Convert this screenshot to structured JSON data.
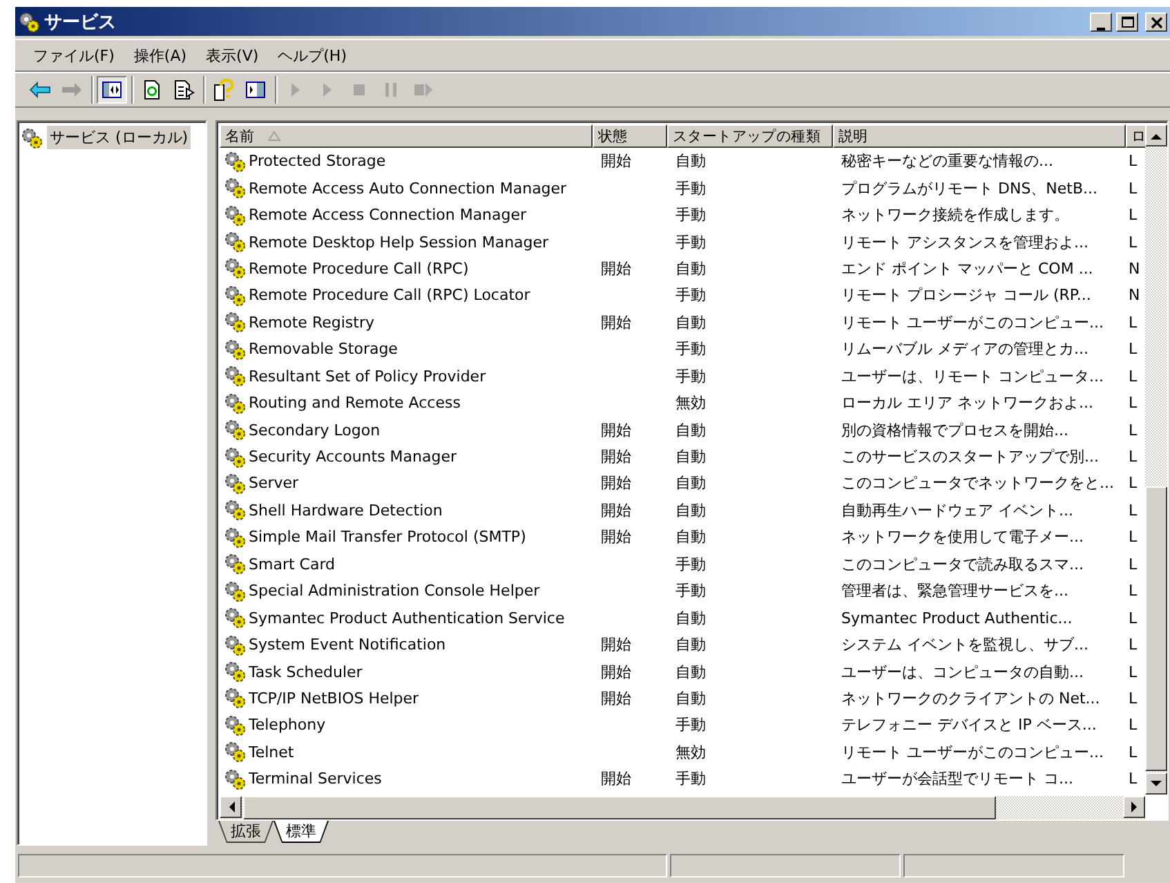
{
  "window": {
    "title": "サービス"
  },
  "menu": [
    "ファイル(F)",
    "操作(A)",
    "表示(V)",
    "ヘルプ(H)"
  ],
  "toolbar": {
    "groups": [
      [
        {
          "kind": "back",
          "disabled": false,
          "pressed": false
        },
        {
          "kind": "forward",
          "disabled": false,
          "pressed": false
        }
      ],
      [
        {
          "kind": "tree",
          "disabled": false,
          "pressed": true
        }
      ],
      [
        {
          "kind": "refresh",
          "disabled": false,
          "pressed": false
        },
        {
          "kind": "export",
          "disabled": false,
          "pressed": false
        }
      ],
      [
        {
          "kind": "help",
          "disabled": false,
          "pressed": false
        },
        {
          "kind": "properties",
          "disabled": false,
          "pressed": false
        }
      ],
      [
        {
          "kind": "play",
          "disabled": true,
          "pressed": false
        },
        {
          "kind": "play",
          "disabled": true,
          "pressed": false
        },
        {
          "kind": "stop",
          "disabled": true,
          "pressed": false
        },
        {
          "kind": "pause",
          "disabled": true,
          "pressed": false
        },
        {
          "kind": "restart",
          "disabled": true,
          "pressed": false
        }
      ]
    ]
  },
  "tree": [
    {
      "label": "サービス (ローカル)",
      "selected": true
    }
  ],
  "table": {
    "columns": [
      {
        "label": "名前",
        "sorted": true
      },
      {
        "label": "状態"
      },
      {
        "label": "スタートアップの種類"
      },
      {
        "label": "説明"
      },
      {
        "label": "ロ"
      }
    ],
    "rows": [
      {
        "name": "Protected Storage",
        "status": "開始",
        "startup": "自動",
        "description": "秘密キーなどの重要な情報の...",
        "column_5": "L"
      },
      {
        "name": "Remote Access Auto Connection Manager",
        "startup": "手動",
        "description": "プログラムがリモート DNS、NetB...",
        "column_5": "L"
      },
      {
        "name": "Remote Access Connection Manager",
        "startup": "手動",
        "description": "ネットワーク接続を作成します。",
        "column_5": "L"
      },
      {
        "name": "Remote Desktop Help Session Manager",
        "startup": "手動",
        "description": "リモート アシスタンスを管理およ...",
        "column_5": "L"
      },
      {
        "name": "Remote Procedure Call (RPC)",
        "status": "開始",
        "startup": "自動",
        "description": "エンド ポイント マッパーと COM ...",
        "column_5": "N"
      },
      {
        "name": "Remote Procedure Call (RPC) Locator",
        "startup": "手動",
        "description": "リモート プロシージャ コール (RP...",
        "column_5": "N"
      },
      {
        "name": "Remote Registry",
        "status": "開始",
        "startup": "自動",
        "description": "リモート ユーザーがこのコンピュー...",
        "column_5": "L"
      },
      {
        "name": "Removable Storage",
        "startup": "手動",
        "description": "リムーバブル メディアの管理とカ...",
        "column_5": "L"
      },
      {
        "name": "Resultant Set of Policy Provider",
        "startup": "手動",
        "description": "ユーザーは、リモート コンピュータ...",
        "column_5": "L"
      },
      {
        "name": "Routing and Remote Access",
        "startup": "無効",
        "description": "ローカル エリア ネットワークおよ...",
        "column_5": "L"
      },
      {
        "name": "Secondary Logon",
        "status": "開始",
        "startup": "自動",
        "description": "別の資格情報でプロセスを開始...",
        "column_5": "L"
      },
      {
        "name": "Security Accounts Manager",
        "status": "開始",
        "startup": "自動",
        "description": "このサービスのスタートアップで別...",
        "column_5": "L"
      },
      {
        "name": "Server",
        "status": "開始",
        "startup": "自動",
        "description": "このコンピュータでネットワークをと...",
        "column_5": "L"
      },
      {
        "name": "Shell Hardware Detection",
        "status": "開始",
        "startup": "自動",
        "description": "自動再生ハードウェア イベント...",
        "column_5": "L"
      },
      {
        "name": "Simple Mail Transfer Protocol (SMTP)",
        "status": "開始",
        "startup": "自動",
        "description": "ネットワークを使用して電子メー...",
        "column_5": "L"
      },
      {
        "name": "Smart Card",
        "startup": "手動",
        "description": "このコンピュータで読み取るスマ...",
        "column_5": "L"
      },
      {
        "name": "Special Administration Console Helper",
        "startup": "手動",
        "description": "管理者は、緊急管理サービスを...",
        "column_5": "L"
      },
      {
        "name": "Symantec Product Authentication Service",
        "startup": "自動",
        "description": "Symantec Product Authentic...",
        "column_5": "L"
      },
      {
        "name": "System Event Notification",
        "status": "開始",
        "startup": "自動",
        "description": "システム イベントを監視し、サブ...",
        "column_5": "L"
      },
      {
        "name": "Task Scheduler",
        "status": "開始",
        "startup": "自動",
        "description": "ユーザーは、コンピュータの自動...",
        "column_5": "L"
      },
      {
        "name": "TCP/IP NetBIOS Helper",
        "status": "開始",
        "startup": "自動",
        "description": "ネットワークのクライアントの Net...",
        "column_5": "L"
      },
      {
        "name": "Telephony",
        "startup": "手動",
        "description": "テレフォニー デバイスと IP ベース...",
        "column_5": "L"
      },
      {
        "name": "Telnet",
        "startup": "無効",
        "description": "リモート ユーザーがこのコンピュー...",
        "column_5": "L"
      },
      {
        "name": "Terminal Services",
        "status": "開始",
        "startup": "手動",
        "description": "ユーザーが会話型でリモート コ...",
        "column_5": "L"
      }
    ]
  },
  "view_tabs": [
    {
      "label": "拡張",
      "selected": false
    },
    {
      "label": "標準",
      "selected": true
    }
  ]
}
